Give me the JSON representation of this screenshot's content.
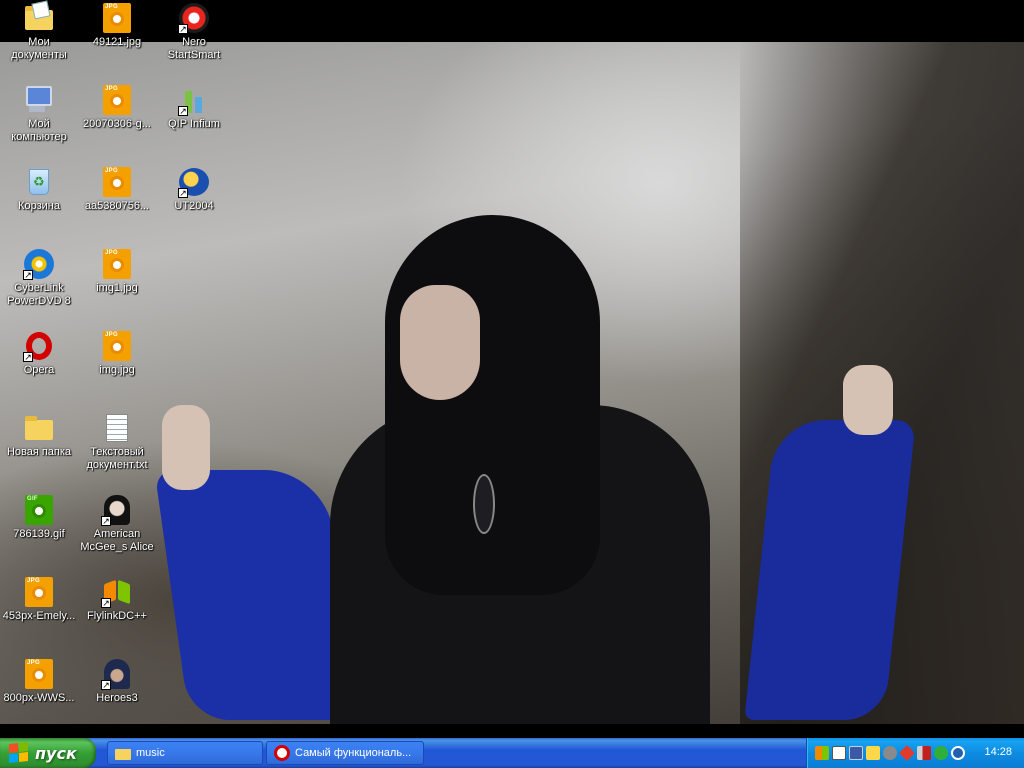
{
  "desktop": {
    "icons": [
      {
        "id": "my-documents",
        "label": "Мои документы",
        "icon": "documents-folder-icon"
      },
      {
        "id": "my-computer",
        "label": "Мой компьютер",
        "icon": "computer-icon"
      },
      {
        "id": "recycle-bin",
        "label": "Корзина",
        "icon": "recycle-bin-icon"
      },
      {
        "id": "powerdvd",
        "label": "CyberLink PowerDVD 8",
        "icon": "dvd-player-icon"
      },
      {
        "id": "opera",
        "label": "Opera",
        "icon": "opera-icon"
      },
      {
        "id": "new-folder",
        "label": "Новая папка",
        "icon": "folder-icon"
      },
      {
        "id": "gif-786139",
        "label": "786139.gif",
        "icon": "gif-file-icon"
      },
      {
        "id": "jpg-453px",
        "label": "453px-Emely...",
        "icon": "jpg-file-icon"
      },
      {
        "id": "jpg-800px",
        "label": "800px-WWS...",
        "icon": "jpg-file-icon"
      },
      {
        "id": "jpg-49121",
        "label": "49121.jpg",
        "icon": "jpg-file-icon"
      },
      {
        "id": "jpg-20070306",
        "label": "20070306-g...",
        "icon": "jpg-file-icon"
      },
      {
        "id": "jpg-aa5380756",
        "label": "aa5380756...",
        "icon": "jpg-file-icon"
      },
      {
        "id": "jpg-img1",
        "label": "img1.jpg",
        "icon": "jpg-file-icon"
      },
      {
        "id": "jpg-img",
        "label": "img.jpg",
        "icon": "jpg-file-icon"
      },
      {
        "id": "text-doc",
        "label": "Текстовый документ.txt",
        "icon": "text-file-icon"
      },
      {
        "id": "alice",
        "label": "American McGee_s Alice",
        "icon": "alice-game-icon"
      },
      {
        "id": "flylink",
        "label": "FlylinkDC++",
        "icon": "flylink-icon"
      },
      {
        "id": "heroes3",
        "label": "Heroes3",
        "icon": "heroes-game-icon"
      },
      {
        "id": "nero",
        "label": "Nero StartSmart",
        "icon": "nero-icon"
      },
      {
        "id": "qip",
        "label": "QIP Infium",
        "icon": "qip-icon"
      },
      {
        "id": "ut2004",
        "label": "UT2004",
        "icon": "ut2004-icon"
      }
    ],
    "file_type_tag_jpg": "JPG",
    "file_type_tag_gif": "GIF"
  },
  "taskbar": {
    "start_label": "пуск",
    "buttons": [
      {
        "label": "music",
        "icon": "folder-icon"
      },
      {
        "label": "Самый функциональ...",
        "icon": "opera-icon"
      }
    ],
    "tray_icons": [
      "flylink-tray-icon",
      "language-tray-icon",
      "network-tray-icon",
      "pen-tray-icon",
      "speaker-tray-icon",
      "antivirus-tray-icon",
      "volume-tray-icon",
      "qip-tray-icon",
      "shield-tray-icon"
    ],
    "clock": "14:28"
  },
  "colors": {
    "taskbar_blue": "#2457d2",
    "start_green": "#35a035",
    "tray_blue": "#0d8ce2",
    "sleeve_blue": "#1b2fa6"
  }
}
